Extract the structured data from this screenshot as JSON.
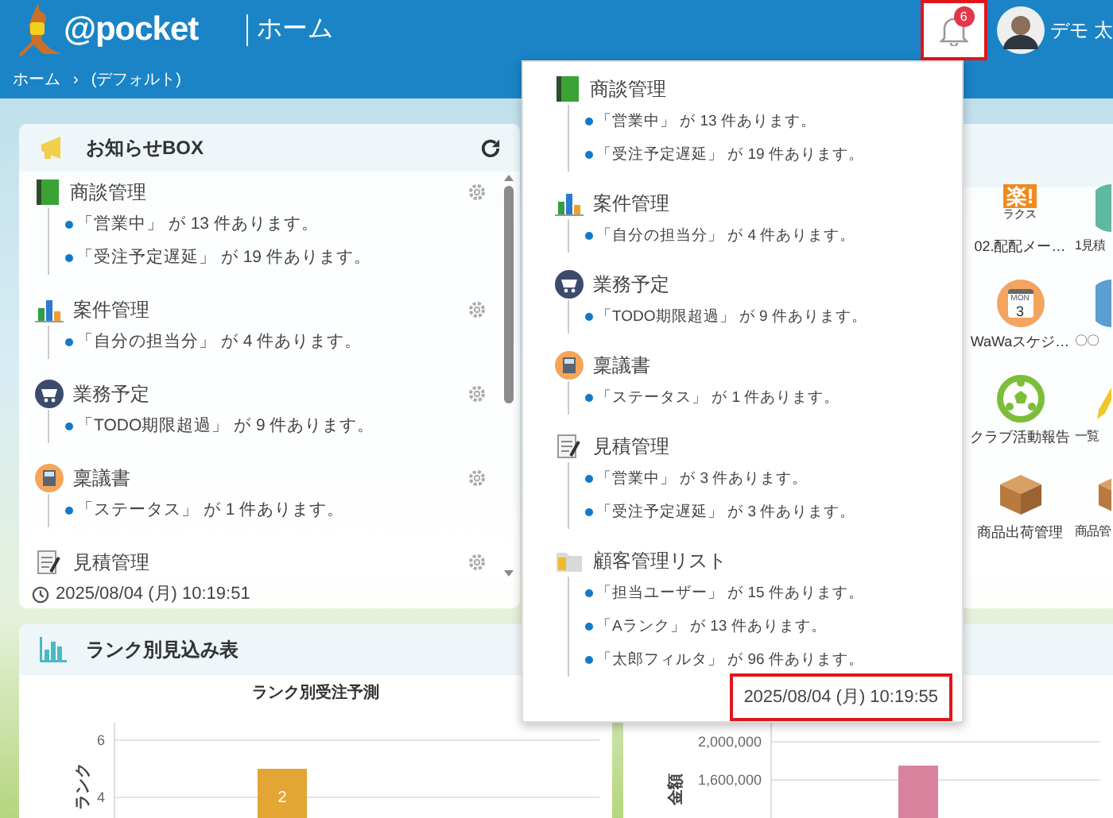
{
  "header": {
    "logo": "@pocket",
    "title": "ホーム",
    "notifications": {
      "count": "6",
      "highlighted": true
    },
    "user_name": "デモ 太"
  },
  "breadcrumb": {
    "items": [
      "ホーム",
      "(デフォルト)"
    ],
    "separator": "›"
  },
  "notice_box": {
    "title": "お知らせBOX",
    "timestamp": "2025/08/04 (月) 10:19:51",
    "groups": [
      {
        "kind": "book",
        "title": "商談管理",
        "items": [
          "「営業中」 が 13 件あります。",
          "「受注予定遅延」 が 19 件あります。"
        ]
      },
      {
        "kind": "chart",
        "title": "案件管理",
        "items": [
          "「自分の担当分」 が 4 件あります。"
        ]
      },
      {
        "kind": "cart",
        "title": "業務予定",
        "items": [
          "「TODO期限超過」 が 9 件あります。"
        ]
      },
      {
        "kind": "calculator",
        "title": "稟議書",
        "items": [
          "「ステータス」 が 1 件あります。"
        ]
      },
      {
        "kind": "notepad",
        "title": "見積管理"
      }
    ]
  },
  "app_launcher": {
    "apps": [
      {
        "kind": "logo",
        "icon_text": [
          "楽!",
          "ラクス"
        ],
        "label": "02.配配メー…"
      },
      {
        "kind": "disc",
        "label": "1見積"
      },
      {
        "kind": "calendar",
        "icon_text": [
          "MON",
          "3"
        ],
        "label": "WaWaスケジ…"
      },
      {
        "kind": "globe",
        "label": "〇〇"
      },
      {
        "kind": "ball",
        "label": "クラブ活動報告"
      },
      {
        "kind": "pencil",
        "label": "一覧"
      },
      {
        "kind": "box",
        "label": "商品出荷管理"
      },
      {
        "kind": "box",
        "label": "商品管"
      }
    ]
  },
  "rank_forecast": {
    "title": "ランク別見込み表",
    "chart_data": {
      "type": "bar",
      "title": "ランク別受注予測",
      "ylabel": "ランク",
      "categories": [
        null
      ],
      "series": [
        {
          "color": "#e3a534",
          "values": [
            5
          ]
        }
      ],
      "ylim": [
        3.28,
        6
      ],
      "yticks": [
        4,
        6
      ],
      "value_labels": [
        "2"
      ]
    }
  },
  "amount_chart": {
    "chart_data": {
      "type": "bar",
      "ylabel": "金額",
      "categories": [
        null
      ],
      "series": [
        {
          "color": "#d9829e",
          "values": [
            1750000
          ]
        }
      ],
      "ylim": [
        1200000,
        2000000
      ],
      "yticks": [
        {
          "value": 1600000,
          "label": "1,600,000"
        },
        {
          "value": 2000000,
          "label": "2,000,000"
        }
      ]
    }
  },
  "notification_popup": {
    "timestamp": "2025/08/04 (月) 10:19:55",
    "timestamp_highlighted": true,
    "groups": [
      {
        "kind": "book",
        "title": "商談管理",
        "items": [
          "「営業中」 が 13 件あります。",
          "「受注予定遅延」 が 19 件あります。"
        ]
      },
      {
        "kind": "chart",
        "title": "案件管理",
        "items": [
          "「自分の担当分」 が 4 件あります。"
        ]
      },
      {
        "kind": "cart",
        "title": "業務予定",
        "items": [
          "「TODO期限超過」 が 9 件あります。"
        ]
      },
      {
        "kind": "calculator",
        "title": "稟議書",
        "items": [
          "「ステータス」 が 1 件あります。"
        ]
      },
      {
        "kind": "notepad",
        "title": "見積管理",
        "items": [
          "「営業中」 が 3 件あります。",
          "「受注予定遅延」 が 3 件あります。"
        ]
      },
      {
        "kind": "folder",
        "title": "顧客管理リスト",
        "items": [
          "「担当ユーザー」 が 15 件あります。",
          "「Aランク」 が 13 件あります。",
          "「太郎フィルタ」 が 96 件あります。"
        ]
      }
    ]
  }
}
